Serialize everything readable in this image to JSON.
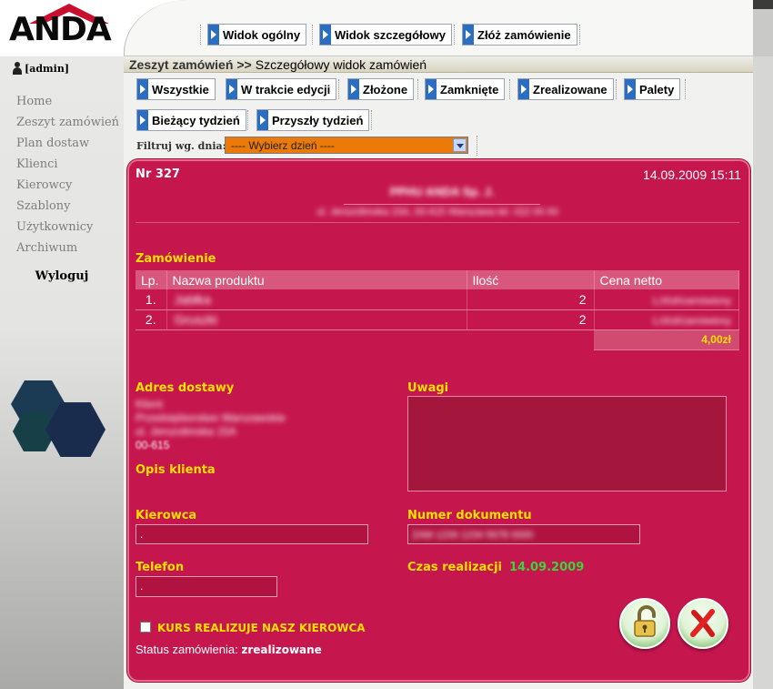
{
  "brand": {
    "logo_text": "ANDA"
  },
  "top_nav": {
    "items": [
      {
        "label": "Widok ogólny"
      },
      {
        "label": "Widok szczegółowy"
      },
      {
        "label": "Złóż zamówienie"
      }
    ]
  },
  "sidebar": {
    "user": "[admin]",
    "items": [
      {
        "label": "Home"
      },
      {
        "label": "Zeszyt zamówień"
      },
      {
        "label": "Plan dostaw"
      },
      {
        "label": "Klienci"
      },
      {
        "label": "Kierowcy"
      },
      {
        "label": "Szablony"
      },
      {
        "label": "Użytkownicy"
      },
      {
        "label": "Archiwum"
      }
    ],
    "logout": "Wyloguj"
  },
  "breadcrumb": {
    "section": "Zeszyt zamówień",
    "separator": ">>",
    "page": "Szczegółowy widok zamówień"
  },
  "filters": {
    "status_buttons": [
      {
        "label": "Wszystkie"
      },
      {
        "label": "W trakcie edycji"
      },
      {
        "label": "Złożone"
      },
      {
        "label": "Zamknięte"
      },
      {
        "label": "Zrealizowane"
      },
      {
        "label": "Palety"
      }
    ],
    "week_buttons": [
      {
        "label": "Bieżący tydzień"
      },
      {
        "label": "Przyszły tydzień"
      }
    ],
    "day_label": "Filtruj wg. dnia:",
    "day_select": "---- Wybierz dzień ----"
  },
  "order": {
    "number": "Nr 327",
    "timestamp": "14.09.2009 15:11",
    "company_name": "PPHU ANDA Sp. J.",
    "company_address": "ul. Jerozolimska 15A, 00-615 Warszawa tel. 022 00 00",
    "section_title": "Zamówienie",
    "table": {
      "headers": [
        "Lp.",
        "Nazwa produktu",
        "Ilość",
        "Cena netto"
      ],
      "rows": [
        {
          "lp": "1.",
          "name": "Jabłka",
          "qty": "2",
          "price": "1,00zł/zamówiony"
        },
        {
          "lp": "2.",
          "name": "Gruszki",
          "qty": "2",
          "price": "1,00zł/zamówiony"
        }
      ],
      "total": "4,00zł"
    },
    "delivery_address_label": "Adres dostawy",
    "delivery_address_lines": [
      "Klient",
      "Przedsiębiorstwo Warszawskie",
      "ul. Jerozolimska 15A",
      "00-615"
    ],
    "client_description_label": "Opis klienta",
    "notes_label": "Uwagi",
    "notes_value": "",
    "driver_label": "Kierowca",
    "driver_value": ".",
    "document_label": "Numer dokumentu",
    "document_value": "ZAM 1234 1234 5678 0000",
    "phone_label": "Telefon",
    "phone_value": ".",
    "realization_label": "Czas realizacji",
    "realization_value": "14.09.2009",
    "own_driver_label": "KURS REALIZUJE NASZ KIEROWCA",
    "own_driver_checked": false,
    "status_label": "Status zamówienia:",
    "status_value": "zrealizowane"
  },
  "colors": {
    "card_bg": "#c5164e",
    "accent_yellow": "#ffe000",
    "accent_green": "#3cd33c",
    "select_orange": "#ec7a08"
  },
  "icons": {
    "unlock": "unlock-icon",
    "cancel": "red-x-icon"
  }
}
